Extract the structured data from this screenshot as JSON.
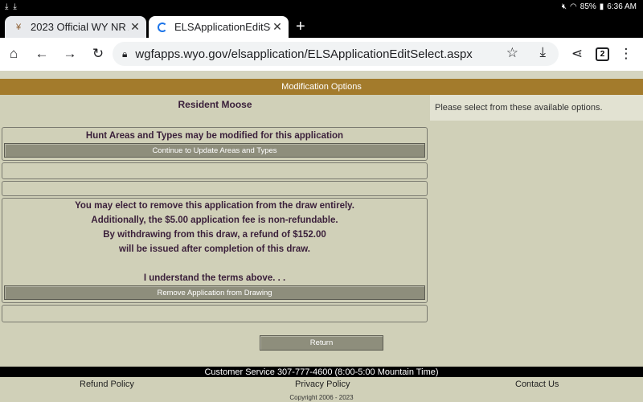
{
  "status_bar": {
    "battery": "85%",
    "time": "6:36 AM"
  },
  "tabs": [
    {
      "title": "2023 Official WY NR Ant",
      "favicon": "deer-icon"
    },
    {
      "title": "ELSApplicationEditSelec",
      "favicon": "loading-spinner-icon"
    }
  ],
  "toolbar": {
    "url": "wgfapps.wyo.gov/elsapplication/ELSApplicationEditSelect.aspx",
    "tab_count": "2"
  },
  "page": {
    "header": "Modification Options",
    "species": "Resident Moose",
    "side_message": "Please select from these available options.",
    "hunt_panel": {
      "text": "Hunt Areas and Types may be modified for this application",
      "button": "Continue to Update Areas and Types"
    },
    "withdraw_panel": {
      "lines": [
        "You may elect to remove this application from the draw entirely.",
        "Additionally, the $5.00 application fee is non-refundable.",
        "By withdrawing from this draw, a refund of $152.00",
        "will be issued after completion of this draw."
      ],
      "confirm": "I understand the terms above. . .",
      "button": "Remove Application from Drawing"
    },
    "return_button": "Return"
  },
  "footer": {
    "customer_service": "Customer Service 307-777-4600 (8:00-5:00 Mountain Time)",
    "links": [
      "Refund Policy",
      "Privacy Policy",
      "Contact Us"
    ],
    "copyright": "Copyright 2006 - 2023"
  }
}
